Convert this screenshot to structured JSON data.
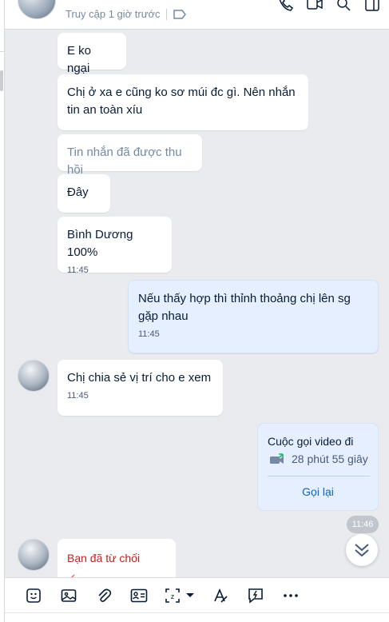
{
  "header": {
    "status": "Truy cập 1 giờ trước"
  },
  "messages": [
    {
      "text": "E ko ngại"
    },
    {
      "text": "Chị ở xa e cũng ko sơ múi đc gì. Nên nhắn tin an toàn xíu"
    },
    {
      "text": "Tin nhắn đã được thu hồi"
    },
    {
      "text": "Đây"
    },
    {
      "text": "Bình Dương 100%",
      "time": "11:45"
    },
    {
      "text": "Nếu thấy hợp thì thỉnh thoảng chị lên sg gặp nhau",
      "time": "11:45"
    },
    {
      "text": "Chị chia sẻ vị trí cho e xem",
      "time": "11:45"
    }
  ],
  "call_card": {
    "title": "Cuộc gọi video đi",
    "duration": "28 phút 55 giây",
    "recall_label": "Gọi lại"
  },
  "time_pill": "11:46",
  "declined": {
    "title": "Bạn đã từ chối"
  },
  "toolbar": {
    "icons": [
      "sticker-icon",
      "image-icon",
      "attachment-icon",
      "contact-card-icon",
      "screenshot-icon",
      "text-format-icon",
      "quick-message-icon",
      "more-icon"
    ]
  }
}
